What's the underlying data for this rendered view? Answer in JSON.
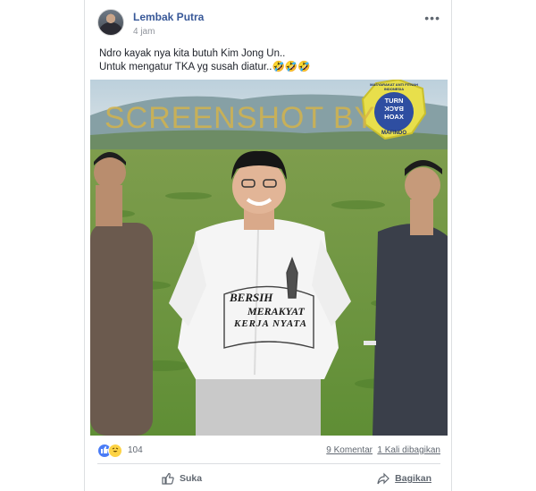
{
  "post": {
    "author": "Lembak Putra",
    "time": "4 jam",
    "text_line1": "Ndro kayak nya kita butuh Kim Jong Un..",
    "text_line2": "Untuk mengatur TKA yg susah diatur..🤣🤣🤣",
    "more_icon": "•••"
  },
  "photo": {
    "watermark": "SCREENSHOT BY",
    "badge_top": "MASYARAKAT ANTI FITNAH INDONESIA",
    "badge_center_1": "TURN",
    "badge_center_2": "BACK",
    "badge_center_3": "HOAX",
    "badge_bottom": "MAFINDO",
    "logo_line1": "BERSIH",
    "logo_line2": "MERAKYAT",
    "logo_line3": "KERJA NYATA"
  },
  "stats": {
    "reaction_count": "104",
    "comments": "9 Komentar",
    "shares": "1 Kali dibagikan"
  },
  "actions": {
    "like": "Suka",
    "share": "Bagikan"
  },
  "colors": {
    "link_blue": "#385898",
    "badge_yellow": "#e8df4b",
    "badge_blue": "#2e4ea1"
  }
}
